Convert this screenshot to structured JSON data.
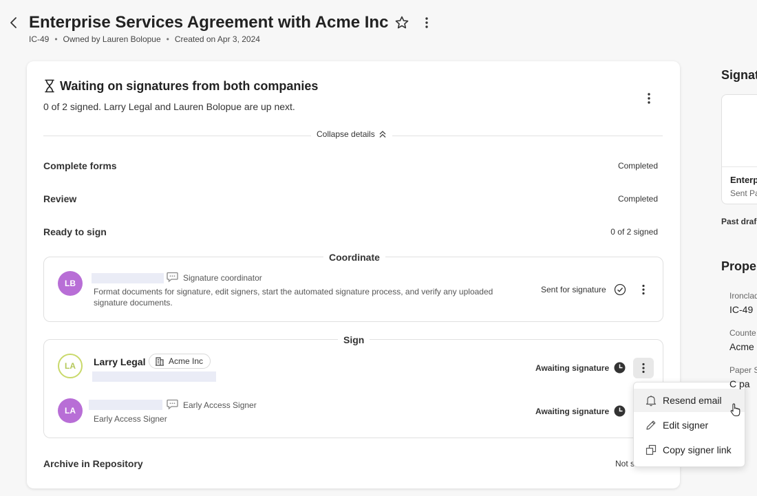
{
  "header": {
    "title": "Enterprise Services Agreement with Acme Inc",
    "id": "IC-49",
    "owner": "Owned by Lauren Bolopue",
    "created": "Created on Apr 3, 2024"
  },
  "status": {
    "title": "Waiting on signatures from both companies",
    "subtitle": "0 of 2 signed. Larry Legal and Lauren Bolopue are up next.",
    "collapse_label": "Collapse details"
  },
  "steps": [
    {
      "label": "Complete forms",
      "value": "Completed"
    },
    {
      "label": "Review",
      "value": "Completed"
    },
    {
      "label": "Ready to sign",
      "value": "0 of 2 signed"
    },
    {
      "label": "Archive in Repository",
      "value": "Not s"
    }
  ],
  "coordinate": {
    "title": "Coordinate",
    "avatar": "LB",
    "role": "Signature coordinator",
    "description": "Format documents for signature, edit signers, start the automated signature process, and verify any uploaded signature documents.",
    "status": "Sent for signature"
  },
  "sign": {
    "title": "Sign",
    "signers": [
      {
        "avatar": "LA",
        "name": "Larry Legal",
        "company": "Acme Inc",
        "status": "Awaiting signature"
      },
      {
        "avatar": "LA",
        "role": "Early Access Signer",
        "subrole": "Early Access Signer",
        "status": "Awaiting signature"
      }
    ]
  },
  "menu": {
    "items": [
      "Resend email",
      "Edit signer",
      "Copy signer link"
    ]
  },
  "right": {
    "signatures_heading": "Signat",
    "card_title": "Enterp",
    "card_sub": "Sent Pa",
    "past_drafts": "Past draf",
    "properties_heading": "Prope",
    "props": [
      {
        "label": "Ironclad",
        "value": "IC-49"
      },
      {
        "label": "Counte",
        "value": "Acme I"
      },
      {
        "label": "Paper S",
        "value": "C pa"
      }
    ]
  },
  "colors": {
    "avatar_purple": "#b86ed6",
    "avatar_outline": "#c9d96a",
    "redaction": "#eaecf6"
  }
}
